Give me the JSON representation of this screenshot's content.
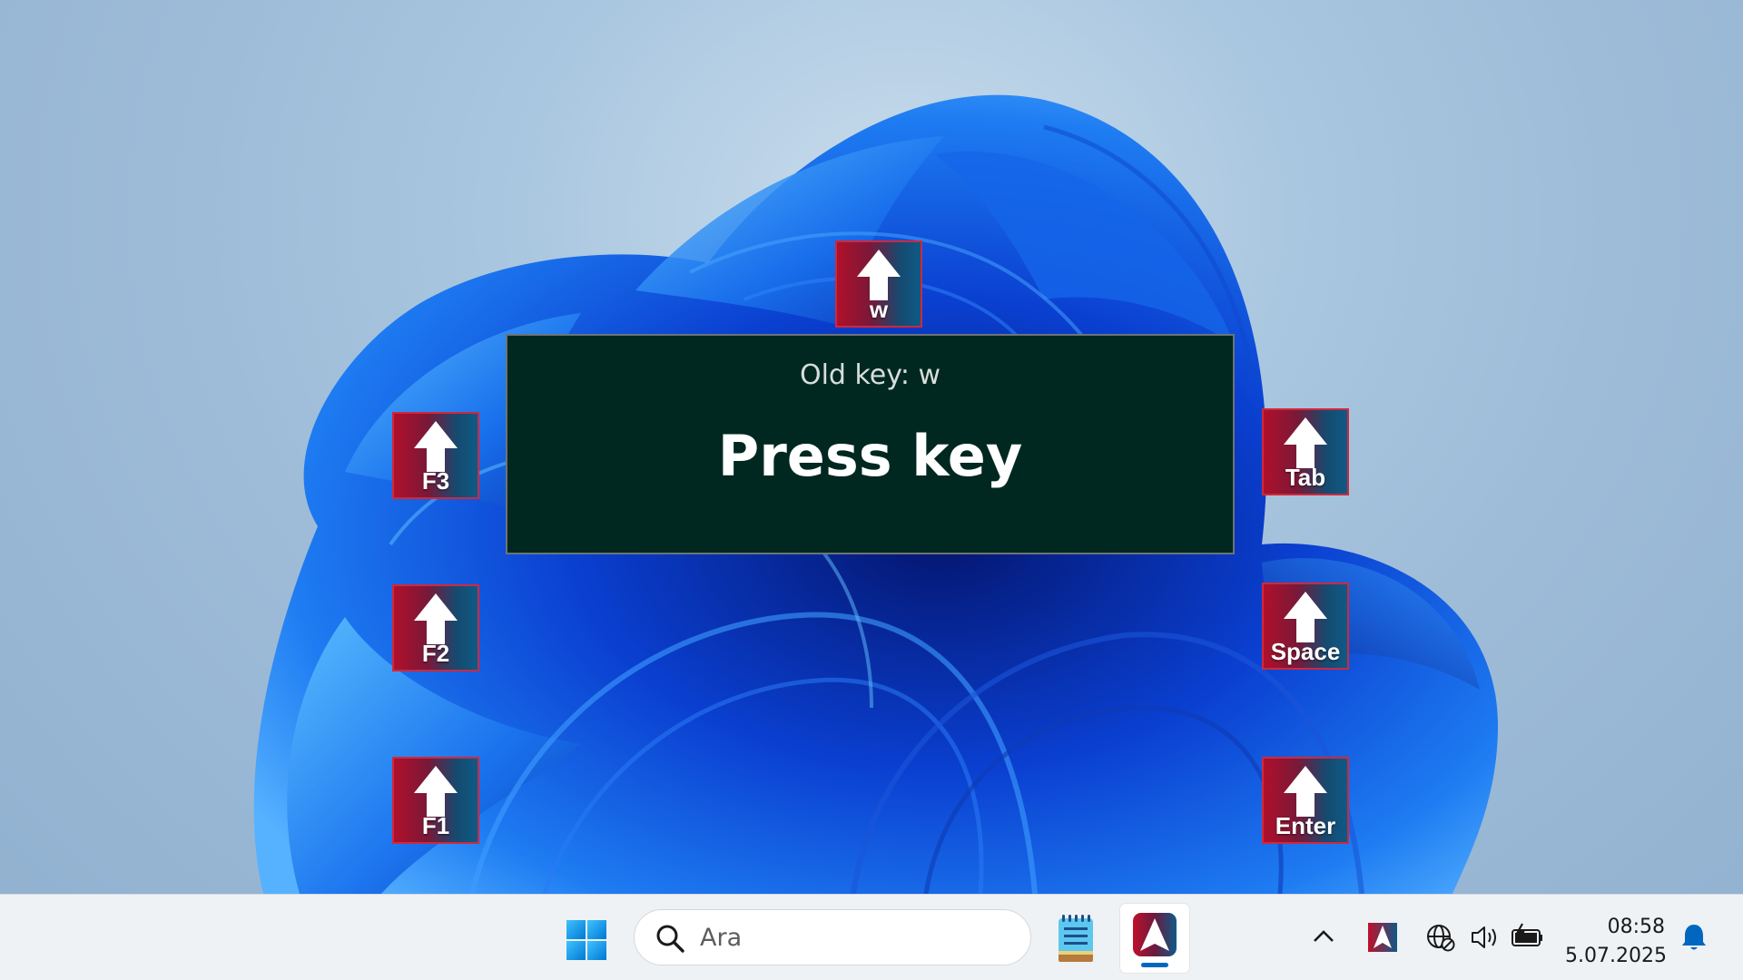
{
  "dialog": {
    "old_key_text": "Old key: w",
    "prompt_text": "Press key"
  },
  "desktop_keys": [
    {
      "id": "w",
      "label": "w",
      "icon": "arrow-up-icon"
    },
    {
      "id": "f3",
      "label": "F3",
      "icon": "arrow-up-icon"
    },
    {
      "id": "f2",
      "label": "F2",
      "icon": "arrow-up-icon"
    },
    {
      "id": "f1",
      "label": "F1",
      "icon": "arrow-up-icon"
    },
    {
      "id": "tab",
      "label": "Tab",
      "icon": "arrow-up-icon"
    },
    {
      "id": "space",
      "label": "Space",
      "icon": "arrow-up-icon"
    },
    {
      "id": "enter",
      "label": "Enter",
      "icon": "arrow-up-icon"
    }
  ],
  "taskbar": {
    "search_placeholder": "Ara",
    "apps": [
      "windows-start-icon",
      "notepad-icon",
      "keymapper-app-icon"
    ],
    "tray_icons": [
      "chevron-up-icon",
      "keymapper-tray-icon",
      "network-globe-icon",
      "volume-icon",
      "battery-charging-icon",
      "notification-bell-icon"
    ],
    "clock": {
      "time": "08:58",
      "date": "5.07.2025"
    }
  },
  "colors": {
    "dialog_bg": "#002820",
    "accent": "#0067c0",
    "key_red": "#b0102a",
    "key_blue": "#0e5a86"
  }
}
